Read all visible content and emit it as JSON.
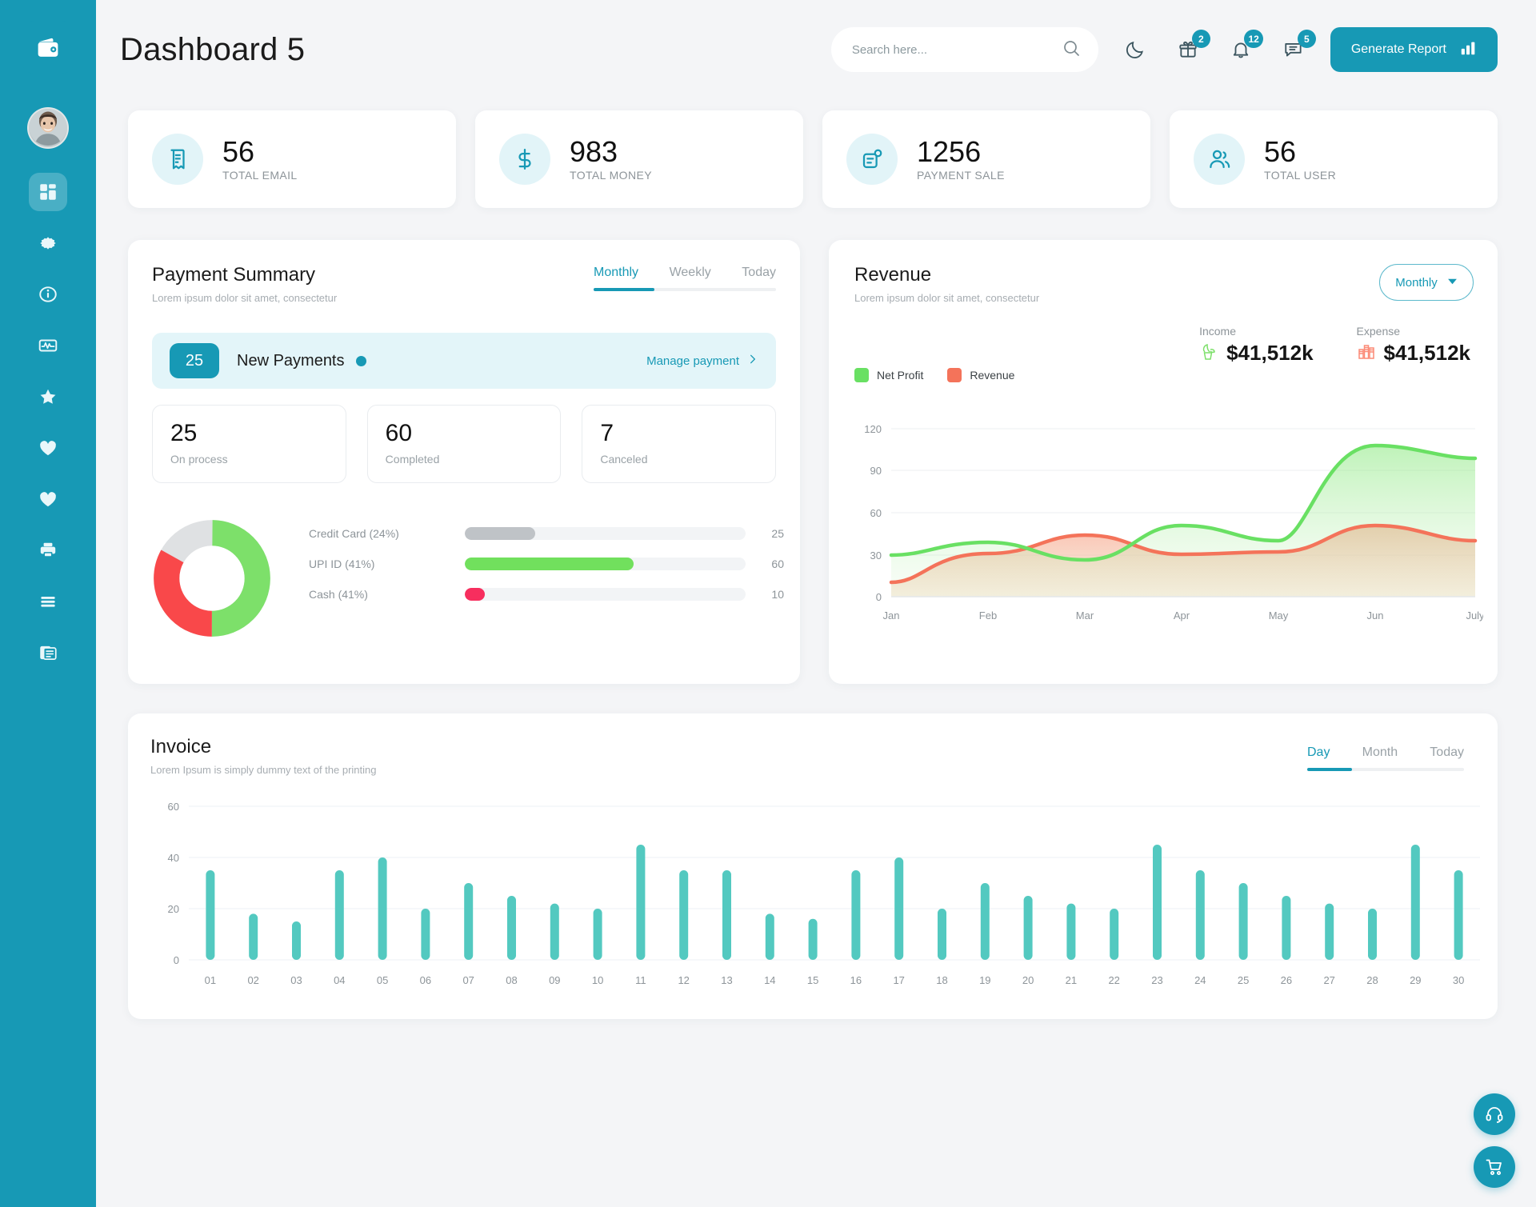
{
  "header": {
    "title": "Dashboard 5",
    "logo_icon": "wallet-icon",
    "search": {
      "placeholder": "Search here...",
      "value": "",
      "icon": "search-icon"
    },
    "theme_toggle_icon": "moon-icon",
    "icons": [
      {
        "name": "gift-icon",
        "badge": "2"
      },
      {
        "name": "bell-icon",
        "badge": "12"
      },
      {
        "name": "chat-icon",
        "badge": "5"
      }
    ],
    "generate_report": {
      "label": "Generate Report",
      "icon": "bar-chart-icon"
    }
  },
  "sidebar": {
    "brand_icon": "wallet-icon",
    "avatar": "user-avatar",
    "items": [
      {
        "name": "dashboard-icon",
        "active": true
      },
      {
        "name": "gear-icon",
        "active": false
      },
      {
        "name": "info-icon",
        "active": false
      },
      {
        "name": "activity-icon",
        "active": false
      },
      {
        "name": "star-icon",
        "active": false
      },
      {
        "name": "heart-icon",
        "active": false
      },
      {
        "name": "heart-filled-icon",
        "active": false
      },
      {
        "name": "printer-icon",
        "active": false
      },
      {
        "name": "menu-icon",
        "active": false
      },
      {
        "name": "documents-icon",
        "active": false
      }
    ]
  },
  "stats": [
    {
      "value": "56",
      "label": "TOTAL EMAIL",
      "icon": "receipt-icon"
    },
    {
      "value": "983",
      "label": "TOTAL MONEY",
      "icon": "dollar-icon"
    },
    {
      "value": "1256",
      "label": "PAYMENT SALE",
      "icon": "invoice-icon"
    },
    {
      "value": "56",
      "label": "TOTAL USER",
      "icon": "users-icon"
    }
  ],
  "payment_summary": {
    "title": "Payment Summary",
    "subtitle": "Lorem ipsum dolor sit amet, consectetur",
    "tabs": [
      {
        "label": "Monthly",
        "active": true
      },
      {
        "label": "Weekly",
        "active": false
      },
      {
        "label": "Today",
        "active": false
      }
    ],
    "banner": {
      "count": "25",
      "label": "New Payments",
      "link": "Manage payment",
      "chevron_icon": "chevron-right-icon"
    },
    "mini_stats": [
      {
        "value": "25",
        "label": "On process"
      },
      {
        "value": "60",
        "label": "Completed"
      },
      {
        "value": "7",
        "label": "Canceled"
      }
    ],
    "methods": [
      {
        "label": "Credit Card (24%)",
        "value": "25",
        "percent": 24,
        "color": "#bfc3c7",
        "bar_percent": 25
      },
      {
        "label": "UPI ID (41%)",
        "value": "60",
        "percent": 41,
        "color": "#71e05d",
        "bar_percent": 60
      },
      {
        "label": "Cash (41%)",
        "value": "10",
        "percent": 35,
        "color": "#f72e5e",
        "bar_percent": 7
      }
    ],
    "donut": {
      "segments": [
        {
          "name": "UPI ID",
          "percent": 50,
          "color": "#7de06a"
        },
        {
          "name": "Cash",
          "percent": 33,
          "color": "#f9484a"
        },
        {
          "name": "Credit Card",
          "percent": 17,
          "color": "#dfe1e3"
        }
      ]
    }
  },
  "revenue": {
    "title": "Revenue",
    "subtitle": "Lorem ipsum dolor sit amet, consectetur",
    "dropdown": {
      "value": "Monthly",
      "icon": "chevron-down-icon"
    },
    "income": {
      "label": "Income",
      "value": "$41,512k",
      "icon": "money-plant-icon",
      "color": "#7de06a"
    },
    "expense": {
      "label": "Expense",
      "value": "$41,512k",
      "icon": "coins-icon",
      "color": "#fc8a76"
    },
    "chart_data": {
      "type": "area",
      "title": "Revenue",
      "x": [
        "Jan",
        "Feb",
        "Mar",
        "Apr",
        "May",
        "Jun",
        "July"
      ],
      "series": [
        {
          "name": "Net Profit",
          "color": "#69e063",
          "values": [
            30,
            39,
            26,
            51,
            40,
            108,
            99
          ]
        },
        {
          "name": "Revenue",
          "color": "#f4735a",
          "values": [
            10,
            31,
            44,
            30,
            32,
            51,
            40
          ]
        }
      ],
      "ylim": [
        0,
        120
      ],
      "yticks": [
        0,
        30,
        60,
        90,
        120
      ],
      "xlabel": "",
      "ylabel": "",
      "grid": true,
      "legend_position": "top-left"
    }
  },
  "invoice": {
    "title": "Invoice",
    "subtitle": "Lorem Ipsum is simply dummy text of the printing",
    "tabs": [
      {
        "label": "Day",
        "active": true
      },
      {
        "label": "Month",
        "active": false
      },
      {
        "label": "Today",
        "active": false
      }
    ],
    "chart_data": {
      "type": "bar",
      "title": "Invoice",
      "categories": [
        "01",
        "02",
        "03",
        "04",
        "05",
        "06",
        "07",
        "08",
        "09",
        "10",
        "11",
        "12",
        "13",
        "14",
        "15",
        "16",
        "17",
        "18",
        "19",
        "20",
        "21",
        "22",
        "23",
        "24",
        "25",
        "26",
        "27",
        "28",
        "29",
        "30"
      ],
      "values": [
        35,
        18,
        15,
        35,
        40,
        20,
        30,
        25,
        22,
        20,
        45,
        35,
        35,
        18,
        16,
        35,
        40,
        20,
        30,
        25,
        22,
        20,
        45,
        35,
        30,
        25,
        22,
        20,
        45,
        35
      ],
      "color": "#53c9c0",
      "ylim": [
        0,
        60
      ],
      "yticks": [
        0,
        20,
        40,
        60
      ],
      "xlabel": "",
      "ylabel": "",
      "grid": true
    }
  },
  "floating_actions": [
    {
      "name": "support-icon"
    },
    {
      "name": "cart-icon"
    }
  ],
  "colors": {
    "brand": "#1799b5",
    "accent_green": "#69e063",
    "accent_red": "#f4735a",
    "invoice_bar": "#53c9c0",
    "page_bg": "#f4f5f7"
  }
}
